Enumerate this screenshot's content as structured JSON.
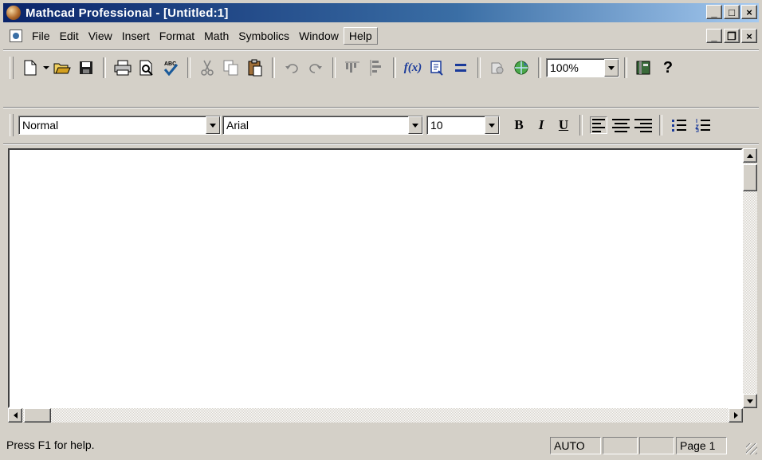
{
  "window": {
    "title": "Mathcad Professional - [Untitled:1]",
    "caption_buttons": {
      "minimize": "_",
      "maximize": "□",
      "close": "×"
    }
  },
  "menubar": {
    "items": [
      "File",
      "Edit",
      "View",
      "Insert",
      "Format",
      "Math",
      "Symbolics",
      "Window",
      "Help"
    ],
    "mdi_buttons": {
      "minimize": "_",
      "restore": "❐",
      "close": "×"
    }
  },
  "toolbar": {
    "icons": [
      "new-document-icon",
      "open-folder-icon",
      "save-disk-icon",
      "print-icon",
      "print-preview-icon",
      "spell-check-icon",
      "cut-icon",
      "copy-icon",
      "paste-icon",
      "undo-icon",
      "redo-icon",
      "align-across-icon",
      "align-down-icon",
      "insert-function-icon",
      "insert-unit-icon",
      "calculate-icon",
      "component-wizard-icon",
      "resource-center-icon",
      "help-icon"
    ],
    "function_label": "f(x)",
    "zoom": "100%",
    "help_glyph": "?"
  },
  "format_bar": {
    "style": "Normal",
    "font": "Arial",
    "size": "10",
    "bold": "B",
    "italic": "I",
    "underline": "U"
  },
  "status": {
    "help_text": "Press F1 for help.",
    "mode": "AUTO",
    "page": "Page 1"
  },
  "colors": {
    "title_gradient_start": "#0a246a",
    "title_gradient_end": "#a6caf0",
    "chrome": "#d4d0c8",
    "worksheet": "#ffffff"
  }
}
